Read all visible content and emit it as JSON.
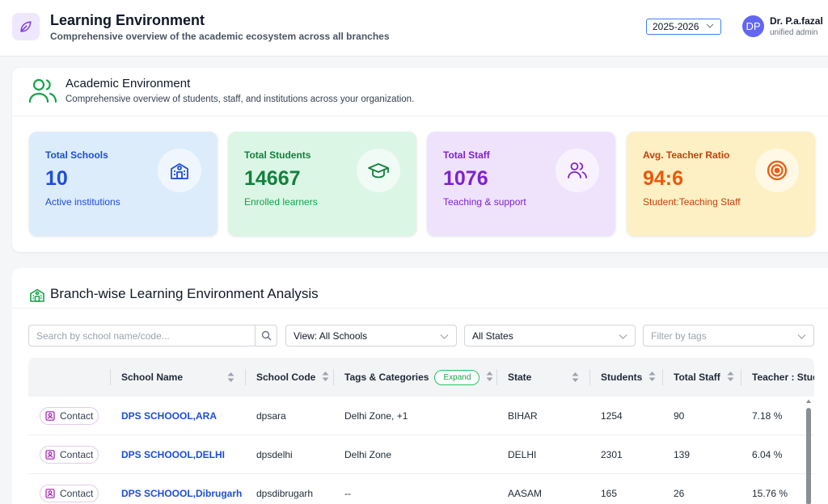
{
  "header": {
    "title": "Learning Environment",
    "subtitle": "Comprehensive overview of the academic ecosystem across all branches",
    "year": "2025-2026",
    "user": {
      "initials": "DP",
      "name": "Dr. P.a.fazal",
      "role": "unified admin"
    }
  },
  "academic": {
    "title": "Academic Environment",
    "subtitle": "Comprehensive overview of students, staff, and institutions across your organization.",
    "stats": [
      {
        "label": "Total Schools",
        "value": "10",
        "desc": "Active institutions",
        "icon": "school-icon"
      },
      {
        "label": "Total Students",
        "value": "14667",
        "desc": "Enrolled learners",
        "icon": "graduation-cap-icon"
      },
      {
        "label": "Total Staff",
        "value": "1076",
        "desc": "Teaching & support",
        "icon": "users-icon"
      },
      {
        "label": "Avg. Teacher Ratio",
        "value": "94:6",
        "desc": "Student:Teaching Staff",
        "icon": "target-icon"
      }
    ]
  },
  "branch": {
    "title": "Branch-wise Learning Environment Analysis",
    "search_placeholder": "Search by school name/code...",
    "view_filter": "View: All Schools",
    "state_filter": "All States",
    "tags_placeholder": "Filter by tags",
    "columns": {
      "school_name": "School Name",
      "school_code": "School Code",
      "tags": "Tags & Categories",
      "expand": "Expand",
      "state": "State",
      "students": "Students",
      "total_staff": "Total Staff",
      "ratio": "Teacher : Stude"
    },
    "contact_label": "Contact",
    "rows": [
      {
        "name": "DPS SCHOOOL,ARA",
        "code": "dpsara",
        "tags": "Delhi Zone, +1",
        "state": "BIHAR",
        "students": "1254",
        "staff": "90",
        "ratio": "7.18 %"
      },
      {
        "name": "DPS SCHOOOL,DELHI",
        "code": "dpsdelhi",
        "tags": "Delhi Zone",
        "state": "DELHI",
        "students": "2301",
        "staff": "139",
        "ratio": "6.04 %"
      },
      {
        "name": "DPS SCHOOOL,Dibrugarh",
        "code": "dpsdibrugarh",
        "tags": "--",
        "state": "AASAM",
        "students": "165",
        "staff": "26",
        "ratio": "15.76 %"
      }
    ]
  },
  "colors": {
    "accent_blue": "#1d4ed8",
    "accent_green": "#15803d",
    "accent_purple": "#7e22ce",
    "accent_orange": "#ea580c"
  }
}
